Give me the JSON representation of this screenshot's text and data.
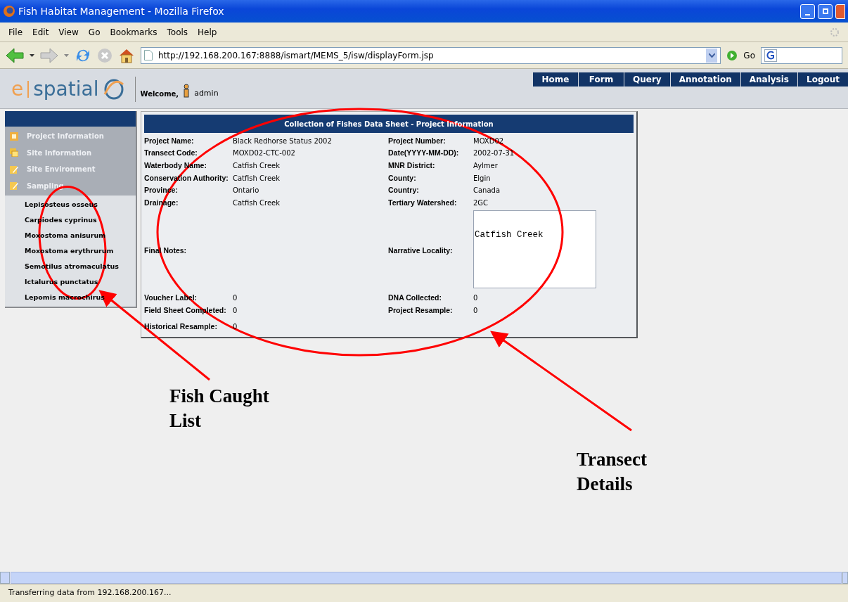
{
  "window": {
    "title": "Fish Habitat Management - Mozilla Firefox"
  },
  "menu": [
    "File",
    "Edit",
    "View",
    "Go",
    "Bookmarks",
    "Tools",
    "Help"
  ],
  "address": {
    "value": "http://192.168.200.167:8888/ismart/MEMS_5/isw/displayForm.jsp",
    "go": "Go"
  },
  "header": {
    "logo_left": "e",
    "logo_right": "spatial",
    "welcome": "Welcome,",
    "user": "admin"
  },
  "nav": [
    "Home",
    "Form",
    "Query",
    "Annotation",
    "Analysis",
    "Logout"
  ],
  "sidebar": {
    "sections": [
      "Project Information",
      "Site Information",
      "Site Environment",
      "Sampling"
    ],
    "species": [
      "Lepisosteus osseus",
      "Carpiodes cyprinus",
      "Moxostoma anisurum",
      "Moxostoma erythrurum",
      "Semotilus atromaculatus",
      "Ictalurus punctatus",
      "Lepomis macrochirus"
    ]
  },
  "form": {
    "title": "Collection of Fishes Data Sheet - Project Information",
    "rows": [
      {
        "kind": "pair",
        "left_label": "Project Name:",
        "left_value": "Black Redhorse Status 2002",
        "right_label": "Project Number:",
        "right_value": "MOXD02"
      },
      {
        "kind": "pair",
        "left_label": "Transect Code:",
        "left_value": "MOXD02-CTC-002",
        "right_label": "Date(YYYY-MM-DD):",
        "right_value": "2002-07-31"
      },
      {
        "kind": "pair",
        "left_label": "Waterbody Name:",
        "left_value": "Catfish Creek",
        "right_label": "MNR District:",
        "right_value": "Aylmer"
      },
      {
        "kind": "pair",
        "left_label": "Conservation Authority:",
        "left_value": "Catfish Creek",
        "right_label": "County:",
        "right_value": "Elgin"
      },
      {
        "kind": "pair",
        "left_label": "Province:",
        "left_value": "Ontario",
        "right_label": "Country:",
        "right_value": "Canada"
      },
      {
        "kind": "pair",
        "left_label": "Drainage:",
        "left_value": "Catfish Creek",
        "right_label": "Tertiary Watershed:",
        "right_value": "2GC"
      },
      {
        "kind": "notes",
        "left_label": "Final Notes:",
        "right_label": "Narrative Locality:",
        "right_value": "Catfish Creek"
      },
      {
        "kind": "pair",
        "left_label": "Voucher Label:",
        "left_value": "0",
        "right_label": "DNA Collected:",
        "right_value": "0"
      },
      {
        "kind": "pair",
        "left_label": "Field Sheet Completed:",
        "left_value": "0",
        "right_label": "Project Resample:",
        "right_value": "0"
      },
      {
        "kind": "single",
        "left_label": "Historical Resample:",
        "left_value": "0"
      }
    ]
  },
  "annotations": [
    "Fish Caught List",
    "Transect Details"
  ],
  "status_bar": "Transferring data from 192.168.200.167..."
}
